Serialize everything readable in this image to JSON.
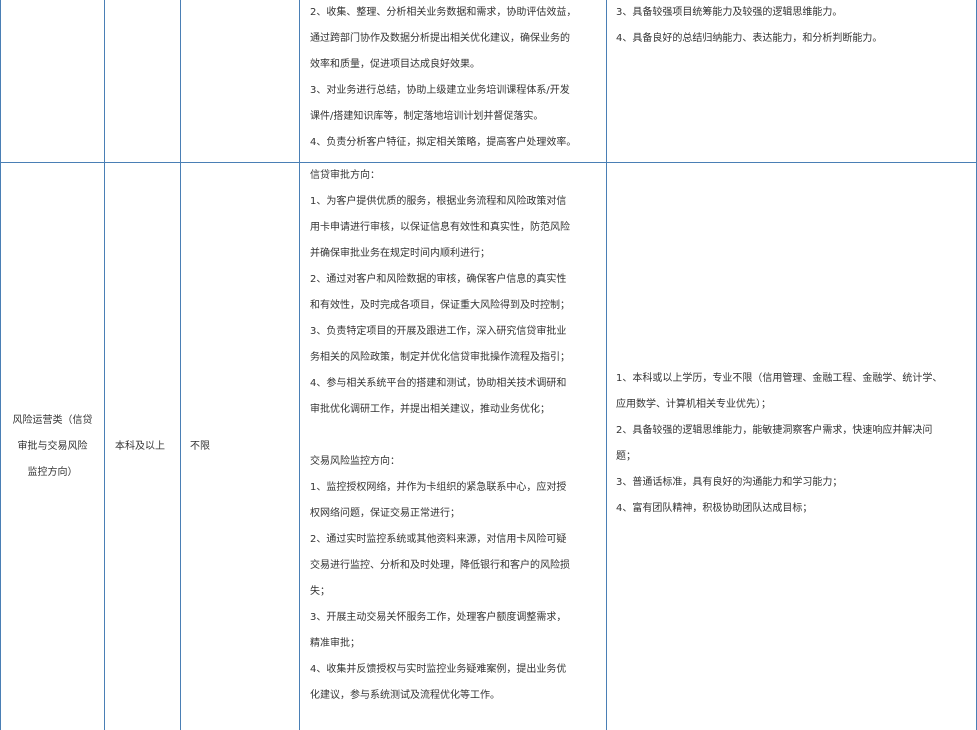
{
  "row1": {
    "duties": [
      "2、收集、整理、分析相关业务数据和需求，协助评估效益，",
      "通过跨部门协作及数据分析提出相关优化建议，确保业务的",
      "效率和质量，促进项目达成良好效果。",
      "3、对业务进行总结，协助上级建立业务培训课程体系/开发",
      "课件/搭建知识库等，制定落地培训计划并督促落实。",
      "4、负责分析客户特征，拟定相关策略，提高客户处理效率。"
    ],
    "requirements": [
      "3、具备较强项目统筹能力及较强的逻辑思维能力。",
      "4、具备良好的总结归纳能力、表达能力，和分析判断能力。"
    ]
  },
  "row2": {
    "category_lines": [
      "风险运营类（信贷",
      "审批与交易风险",
      "监控方向）"
    ],
    "education": "本科及以上",
    "major": "不限",
    "duties": [
      "信贷审批方向：",
      "1、为客户提供优质的服务，根据业务流程和风险政策对信",
      "用卡申请进行审核，以保证信息有效性和真实性，防范风险",
      "并确保审批业务在规定时间内顺利进行；",
      "2、通过对客户和风险数据的审核，确保客户信息的真实性",
      "和有效性，及时完成各项目，保证重大风险得到及时控制；",
      "3、负责特定项目的开展及跟进工作，深入研究信贷审批业",
      "务相关的风险政策，制定并优化信贷审批操作流程及指引；",
      "4、参与相关系统平台的搭建和测试，协助相关技术调研和",
      "审批优化调研工作，并提出相关建议，推动业务优化；",
      "",
      "交易风险监控方向：",
      "1、监控授权网络，并作为卡组织的紧急联系中心，应对授",
      "权网络问题，保证交易正常进行；",
      "2、通过实时监控系统或其他资料来源，对信用卡风险可疑",
      "交易进行监控、分析和及时处理，降低银行和客户的风险损",
      "失；",
      "3、开展主动交易关怀服务工作，处理客户额度调整需求，",
      "精准审批；",
      "4、收集并反馈授权与实时监控业务疑难案例，提出业务优",
      "化建议，参与系统测试及流程优化等工作。"
    ],
    "requirements": [
      "1、本科或以上学历，专业不限（信用管理、金融工程、金融学、统计学、",
      "应用数学、计算机相关专业优先）；",
      "2、具备较强的逻辑思维能力，能敏捷洞察客户需求，快速响应并解决问",
      "题；",
      "3、普通话标准，具有良好的沟通能力和学习能力；",
      "4、富有团队精神，积极协助团队达成目标；"
    ]
  }
}
